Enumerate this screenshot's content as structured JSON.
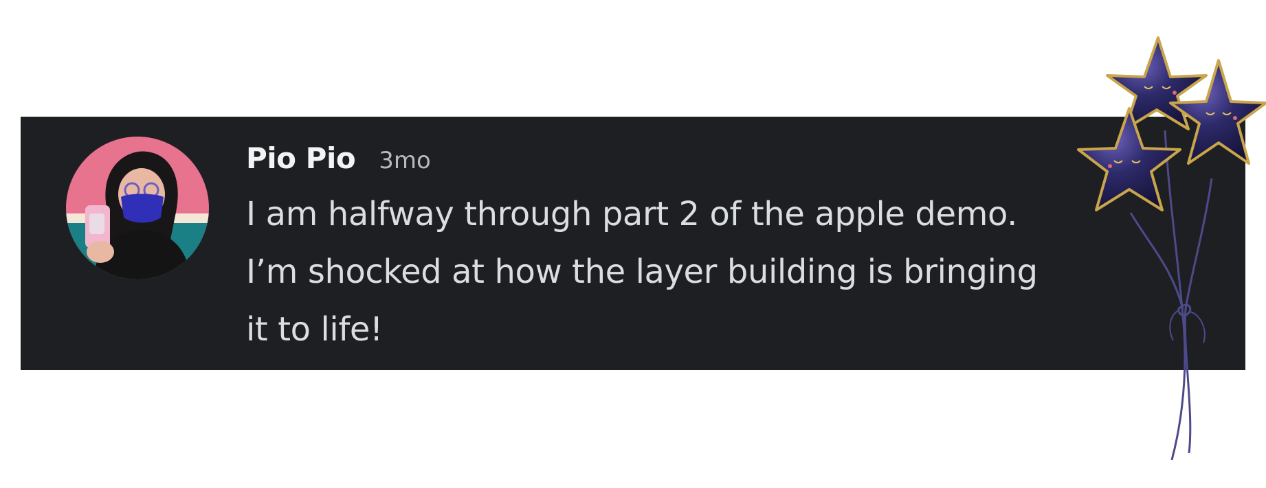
{
  "message": {
    "author": "Pio Pio",
    "timestamp": "3mo",
    "lines": [
      "I am halfway through part 2 of the apple demo.",
      "I’m shocked at how the layer building is bringing",
      "it to life!"
    ]
  },
  "colors": {
    "card_background": "#1e1f22",
    "username": "#f2f3f5",
    "timestamp": "#b5bac1",
    "message_text": "#dbdee1",
    "avatar_background": "#e8738f",
    "balloon": "#2a2860",
    "balloon_rim": "#c9a54b"
  },
  "icons": {
    "avatar": "user-avatar-photo",
    "decoration": "star-balloons-sticker"
  }
}
